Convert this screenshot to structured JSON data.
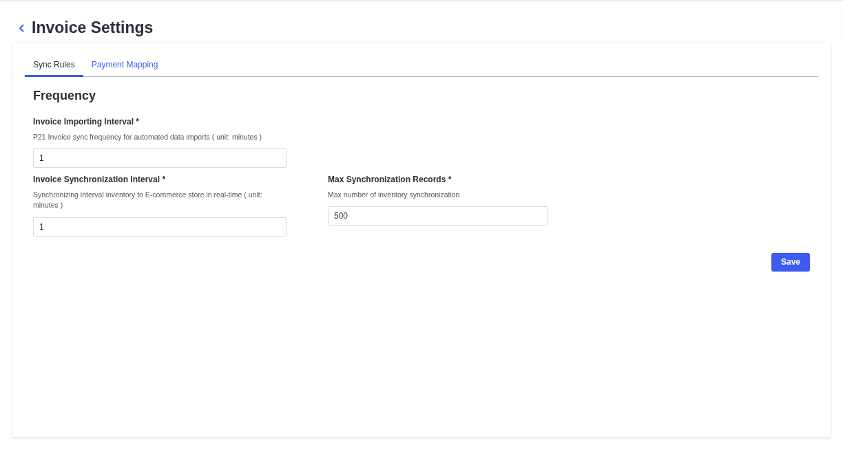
{
  "header": {
    "title": "Invoice Settings"
  },
  "tabs": [
    {
      "label": "Sync Rules",
      "selected": true
    },
    {
      "label": "Payment Mapping",
      "selected": false
    }
  ],
  "section": {
    "title": "Frequency"
  },
  "fields": [
    {
      "label": "Invoice Importing Interval *",
      "description": "P21 Invoice sync frequency for automated data imports ( unit: minutes )",
      "value": "1"
    },
    {
      "label": "Invoice Synchronization Interval *",
      "description": "Synchronizing interval inventory to E-commerce store in real-time ( unit: minutes )",
      "value": "1"
    },
    {
      "label": "Max Synchronization Records *",
      "description": "Max number of inventory synchronization",
      "value": "500"
    }
  ],
  "save_button": "Save"
}
